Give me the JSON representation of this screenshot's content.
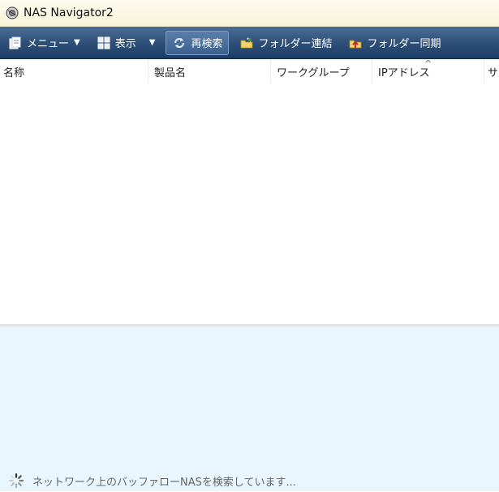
{
  "window": {
    "title": "NAS Navigator2"
  },
  "toolbar": {
    "menu_label": "メニュー",
    "view_label": "表示",
    "rescan_label": "再検索",
    "folder_link_label": "フォルダー連結",
    "folder_sync_label": "フォルダー同期"
  },
  "table": {
    "columns": [
      "名称",
      "製品名",
      "ワークグループ",
      "IPアドレス",
      "サ"
    ],
    "sorted_column": "IPアドレス",
    "rows": []
  },
  "status": {
    "text": "ネットワーク上のバッファローNASを検索しています..."
  },
  "colors": {
    "toolbar_top": "#4d6f97",
    "toolbar_bottom": "#1d3d65",
    "title_bg": "#fdfbee",
    "bottom_panel": "#eaf6fd"
  },
  "icons": [
    "app-icon",
    "menu-icon",
    "view-icon",
    "refresh-icon",
    "folder-link-icon",
    "folder-sync-icon",
    "spinner-icon"
  ]
}
